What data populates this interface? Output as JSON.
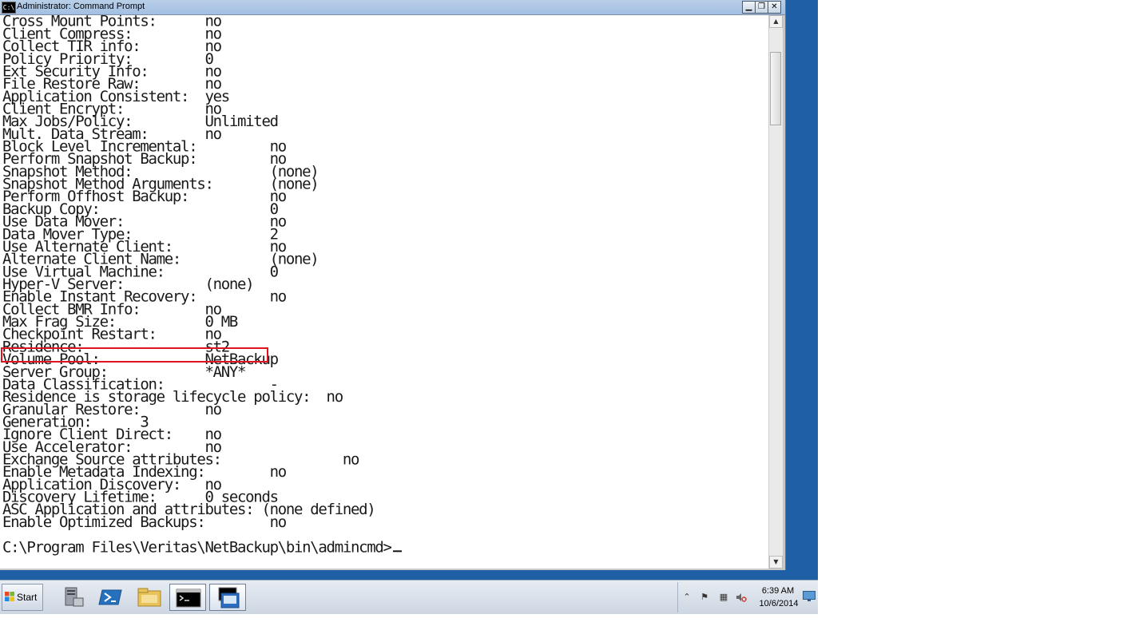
{
  "window": {
    "title": "Administrator: Command Prompt",
    "icon_label": "C:\\",
    "minimize_icon": "minimize-icon",
    "maximize_icon": "maximize-icon",
    "close_icon": "close-icon"
  },
  "console": {
    "lines": [
      "Cross Mount Points:      no",
      "Client Compress:         no",
      "Collect TIR info:        no",
      "Policy Priority:         0",
      "Ext Security Info:       no",
      "File Restore Raw:        no",
      "Application Consistent:  yes",
      "Client Encrypt:          no",
      "Max Jobs/Policy:         Unlimited",
      "Mult. Data Stream:       no",
      "Block Level Incremental:         no",
      "Perform Snapshot Backup:         no",
      "Snapshot Method:                 (none)",
      "Snapshot Method Arguments:       (none)",
      "Perform Offhost Backup:          no",
      "Backup Copy:                     0",
      "Use Data Mover:                  no",
      "Data Mover Type:                 2",
      "Use Alternate Client:            no",
      "Alternate Client Name:           (none)",
      "Use Virtual Machine:             0",
      "Hyper-V Server:          (none)",
      "Enable Instant Recovery:         no",
      "Collect BMR Info:        no",
      "Max Frag Size:           0 MB",
      "Checkpoint Restart:      no",
      "Residence:               st2",
      "Volume Pool:             NetBackup",
      "Server Group:            *ANY*",
      "Data Classification:             -",
      "Residence is storage lifecycle policy:  no",
      "Granular Restore:        no",
      "Generation:      3",
      "Ignore Client Direct:    no",
      "Use Accelerator:         no",
      "Exchange Source attributes:               no",
      "Enable Metadata Indexing:        no",
      "Application Discovery:   no",
      "Discovery Lifetime:      0 seconds",
      "ASC Application and attributes: (none defined)",
      "Enable Optimized Backups:        no",
      "",
      "C:\\Program Files\\Veritas\\NetBackup\\bin\\admincmd>"
    ],
    "highlight_color": "#e0141e"
  },
  "taskbar": {
    "start_label": "Start",
    "items": [
      {
        "name": "server-manager-icon"
      },
      {
        "name": "powershell-icon"
      },
      {
        "name": "explorer-icon"
      },
      {
        "name": "cmd-icon",
        "active": true
      },
      {
        "name": "console-window-icon",
        "active": true
      }
    ],
    "clock_time": "6:39 AM",
    "clock_date": "10/6/2014"
  },
  "colors": {
    "desktop": "#1f5fa6",
    "console_bg": "#ffffff",
    "console_text": "#1a1a1a"
  }
}
